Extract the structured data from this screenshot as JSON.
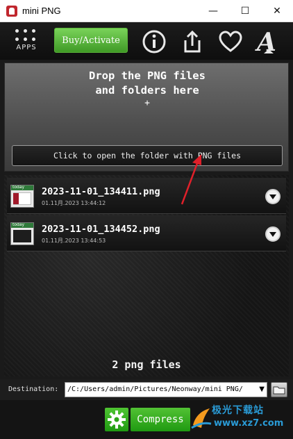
{
  "window": {
    "title": "mini PNG",
    "minimize_glyph": "—",
    "maximize_glyph": "☐",
    "close_glyph": "✕"
  },
  "toolbar": {
    "apps_label": "APPS",
    "buy_label": "Buy/Activate",
    "icons": [
      "info-icon",
      "share-icon",
      "heart-icon",
      "font-icon"
    ]
  },
  "dropzone": {
    "line1": "Drop the PNG files",
    "line2": "and folders here",
    "plus": "+",
    "open_folder_label": "Click to open the folder with PNG files"
  },
  "files": [
    {
      "name": "2023-11-01_134411.png",
      "date": "01.11月.2023 13:44:12",
      "thumb_label": "today"
    },
    {
      "name": "2023-11-01_134452.png",
      "date": "01.11月.2023 13:44:53",
      "thumb_label": "today"
    }
  ],
  "file_count": "2 png files",
  "destination": {
    "label": "Destination:",
    "path": "/C:/Users/admin/Pictures/Neonway/mini PNG/",
    "caret": "▼"
  },
  "actions": {
    "compress_label": "Compress"
  },
  "watermark": {
    "title": "极光下载站",
    "url": "www.xz7.com"
  },
  "colors": {
    "accent_green": "#3f9a26",
    "annotation_arrow": "#e0202a"
  }
}
